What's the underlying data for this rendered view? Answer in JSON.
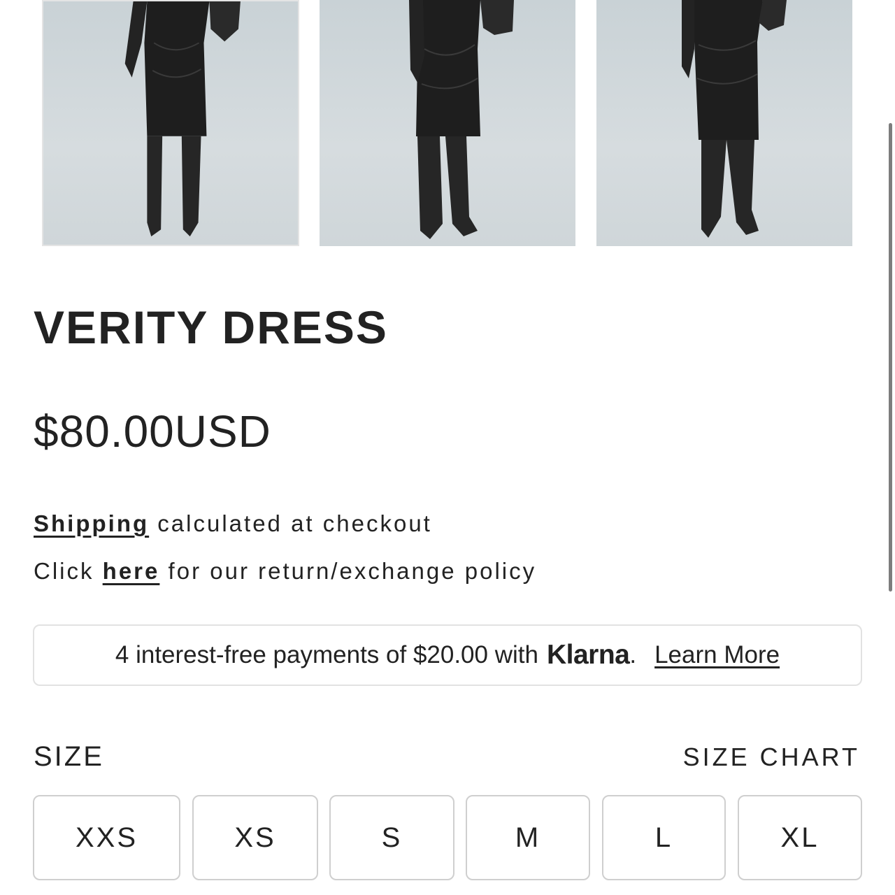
{
  "gallery": {
    "images": [
      {
        "alt": "Verity Dress front view",
        "icon": "model-photo"
      },
      {
        "alt": "Verity Dress angled view",
        "icon": "model-photo"
      },
      {
        "alt": "Verity Dress side view",
        "icon": "model-photo"
      }
    ]
  },
  "product": {
    "title": "VERITY DRESS",
    "price": "$80.00USD",
    "shipping_link": "Shipping",
    "shipping_text": " calculated at checkout",
    "policy_prefix": "Click ",
    "policy_link": "here",
    "policy_suffix": " for our return/exchange policy"
  },
  "klarna": {
    "text": "4 interest-free payments of $20.00 with",
    "logo": "Klarna",
    "logo_dot": ".",
    "learn_more": "Learn More"
  },
  "size": {
    "label": "SIZE",
    "chart_link": "SIZE CHART",
    "options": [
      "XXS",
      "XS",
      "S",
      "M",
      "L",
      "XL"
    ]
  },
  "colors": {
    "text": "#222222",
    "border": "#cfcfcf",
    "photo_bg": "#cfd6d9"
  }
}
